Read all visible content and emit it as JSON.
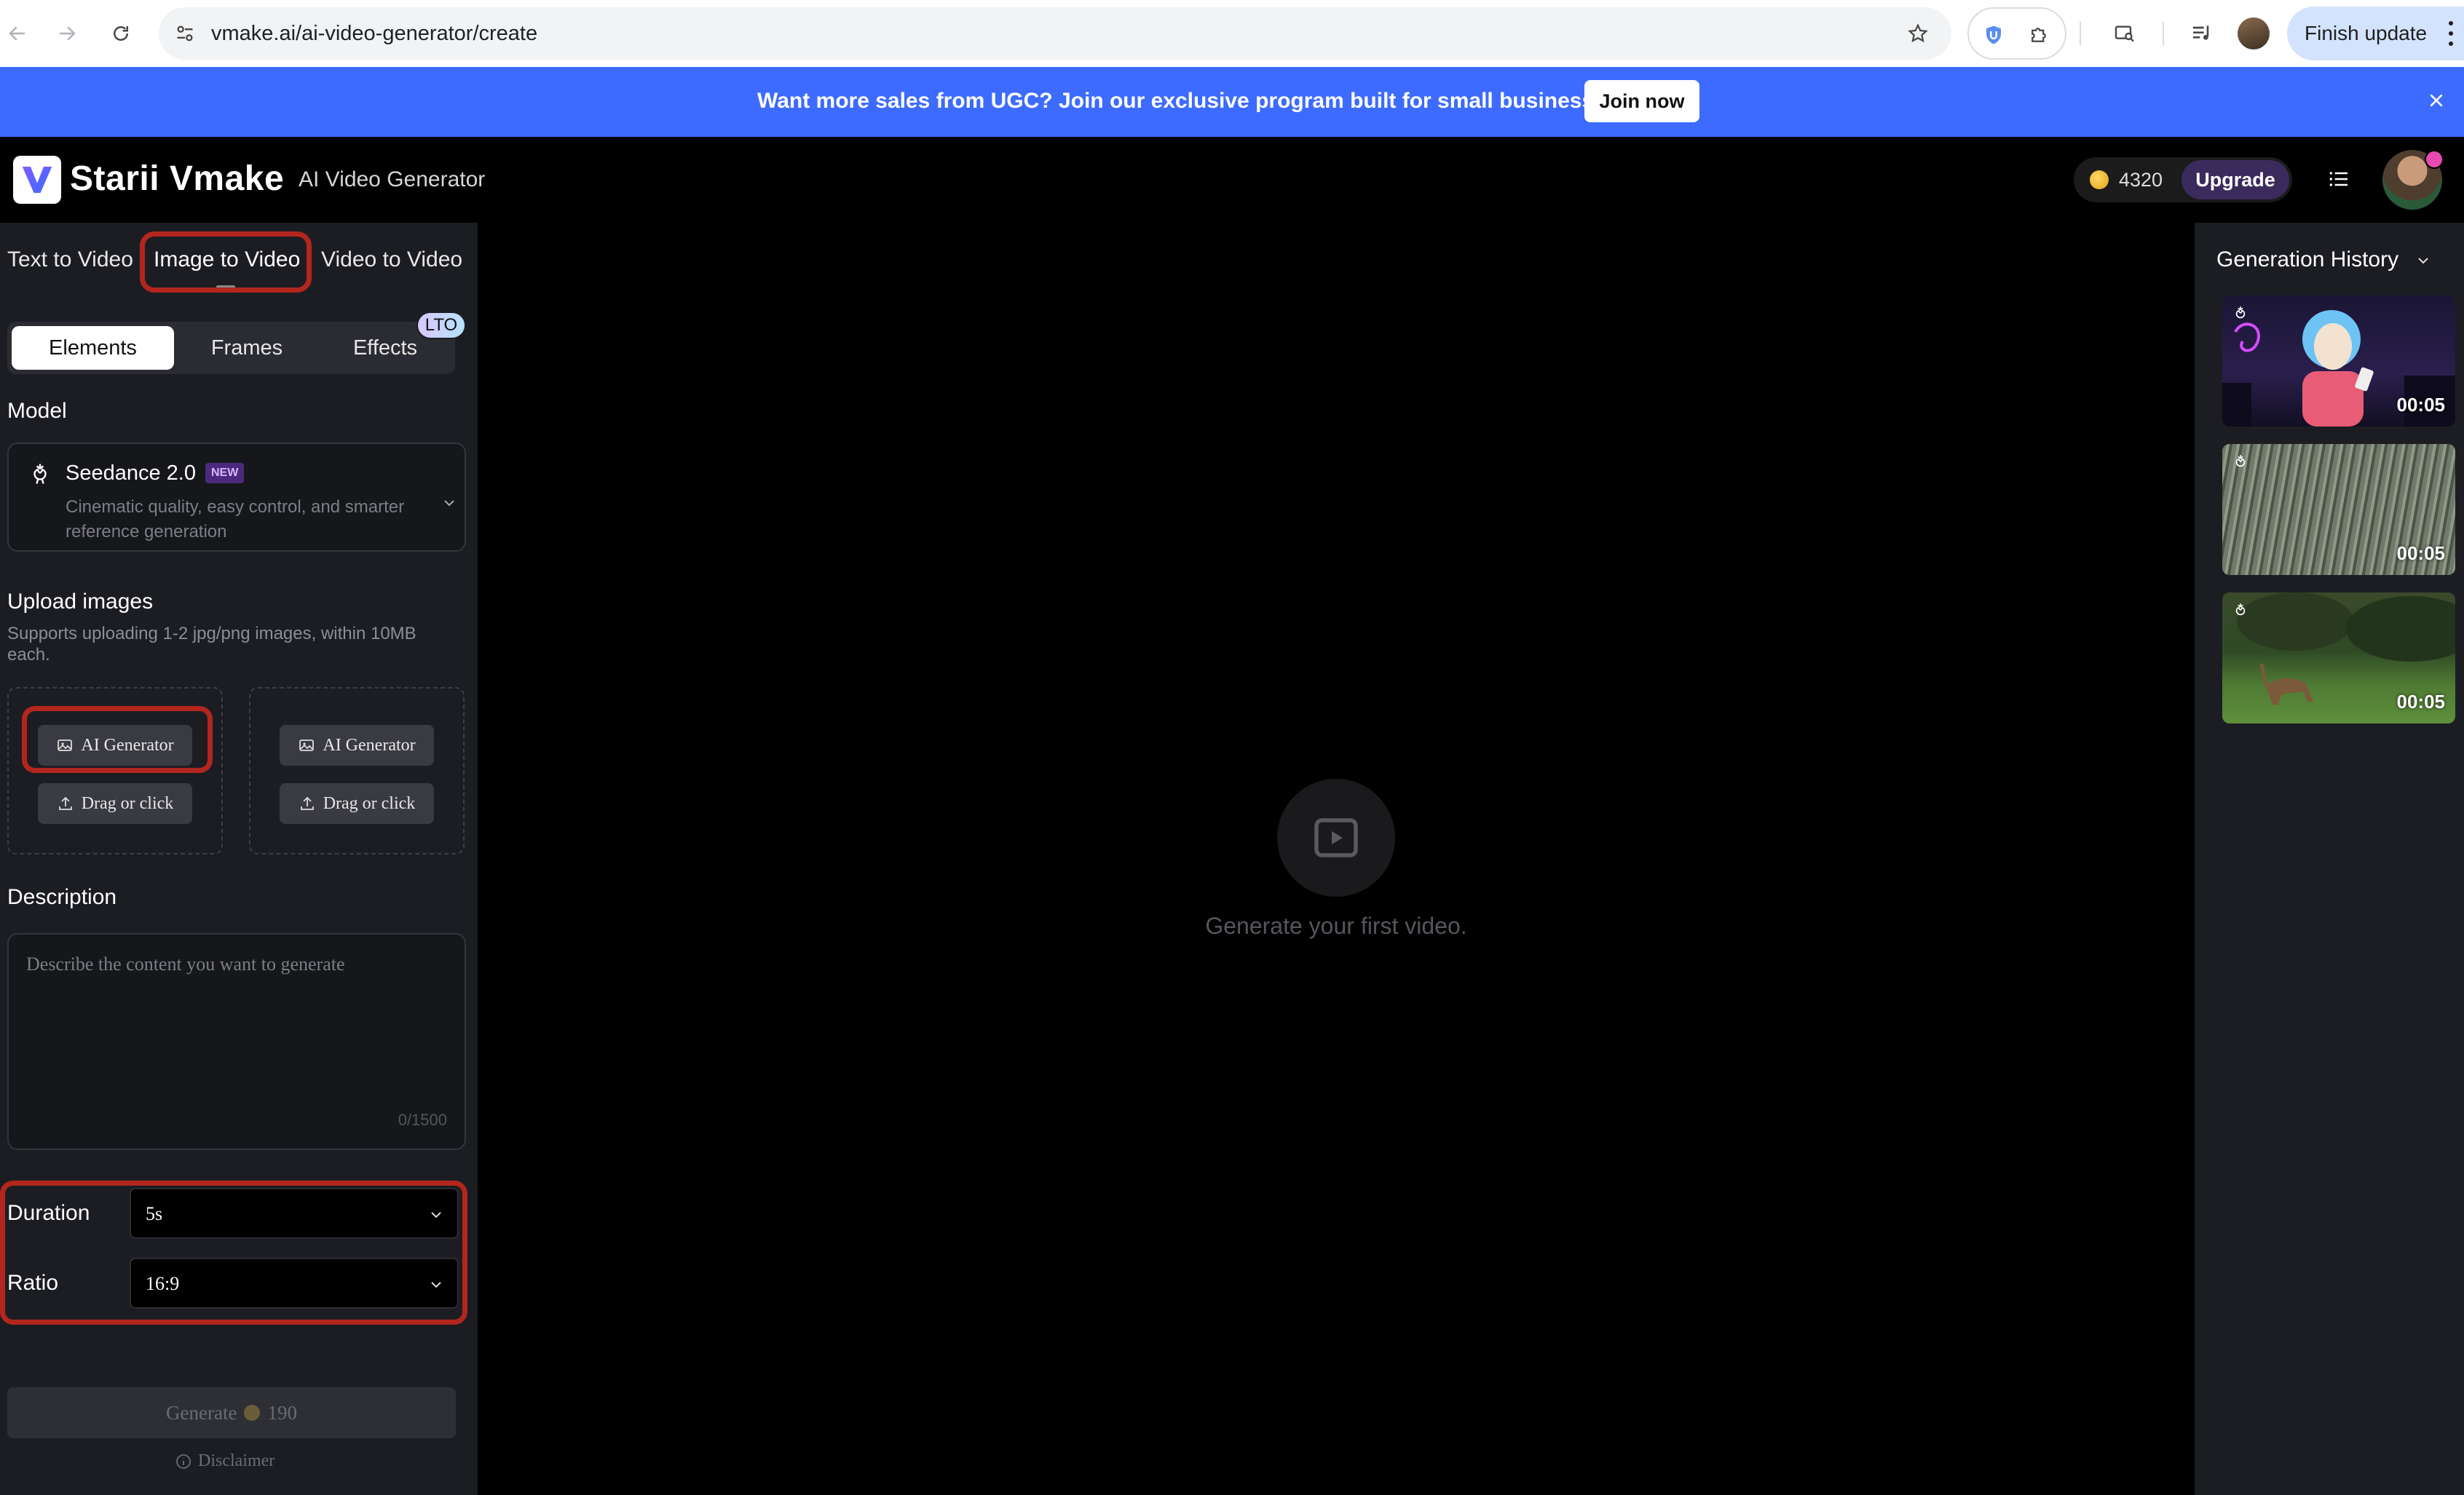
{
  "browser": {
    "url": "vmake.ai/ai-video-generator/create",
    "finish_update": "Finish update"
  },
  "banner": {
    "text": "Want more sales from UGC? Join our exclusive program built for small businesses",
    "cta": "Join now"
  },
  "header": {
    "brand": "Starii Vmake",
    "product": "AI Video Generator",
    "credits": "4320",
    "upgrade": "Upgrade"
  },
  "left_panel": {
    "mode_tabs": [
      "Text to Video",
      "Image to Video",
      "Video to Video"
    ],
    "active_mode": "Image to Video",
    "sub_tabs": [
      "Elements",
      "Frames",
      "Effects"
    ],
    "active_sub_tab": "Elements",
    "lto_badge": "LTO",
    "model_label": "Model",
    "model": {
      "name": "Seedance 2.0",
      "badge": "NEW",
      "description": "Cinematic quality, easy control, and smarter reference generation"
    },
    "upload": {
      "label": "Upload images",
      "hint": "Supports uploading 1-2 jpg/png images, within 10MB each.",
      "slots": [
        {
          "ai_button": "AI Generator",
          "drag_button": "Drag or click"
        },
        {
          "ai_button": "AI Generator",
          "drag_button": "Drag or click"
        }
      ]
    },
    "description": {
      "label": "Description",
      "placeholder": "Describe the content you want to generate",
      "count": "0/1500"
    },
    "duration": {
      "label": "Duration",
      "value": "5s"
    },
    "ratio": {
      "label": "Ratio",
      "value": "16:9"
    },
    "generate": {
      "label": "Generate",
      "cost": "190"
    },
    "disclaimer": "Disclaimer"
  },
  "center": {
    "empty_text": "Generate your first video."
  },
  "history": {
    "title": "Generation History",
    "items": [
      {
        "duration": "00:05"
      },
      {
        "duration": "00:05"
      },
      {
        "duration": "00:05"
      }
    ]
  },
  "colors": {
    "banner": "#3d6bff",
    "highlight_ring": "#b3261e",
    "panel": "#1c1d22",
    "upgrade": "#3a2b5c"
  }
}
